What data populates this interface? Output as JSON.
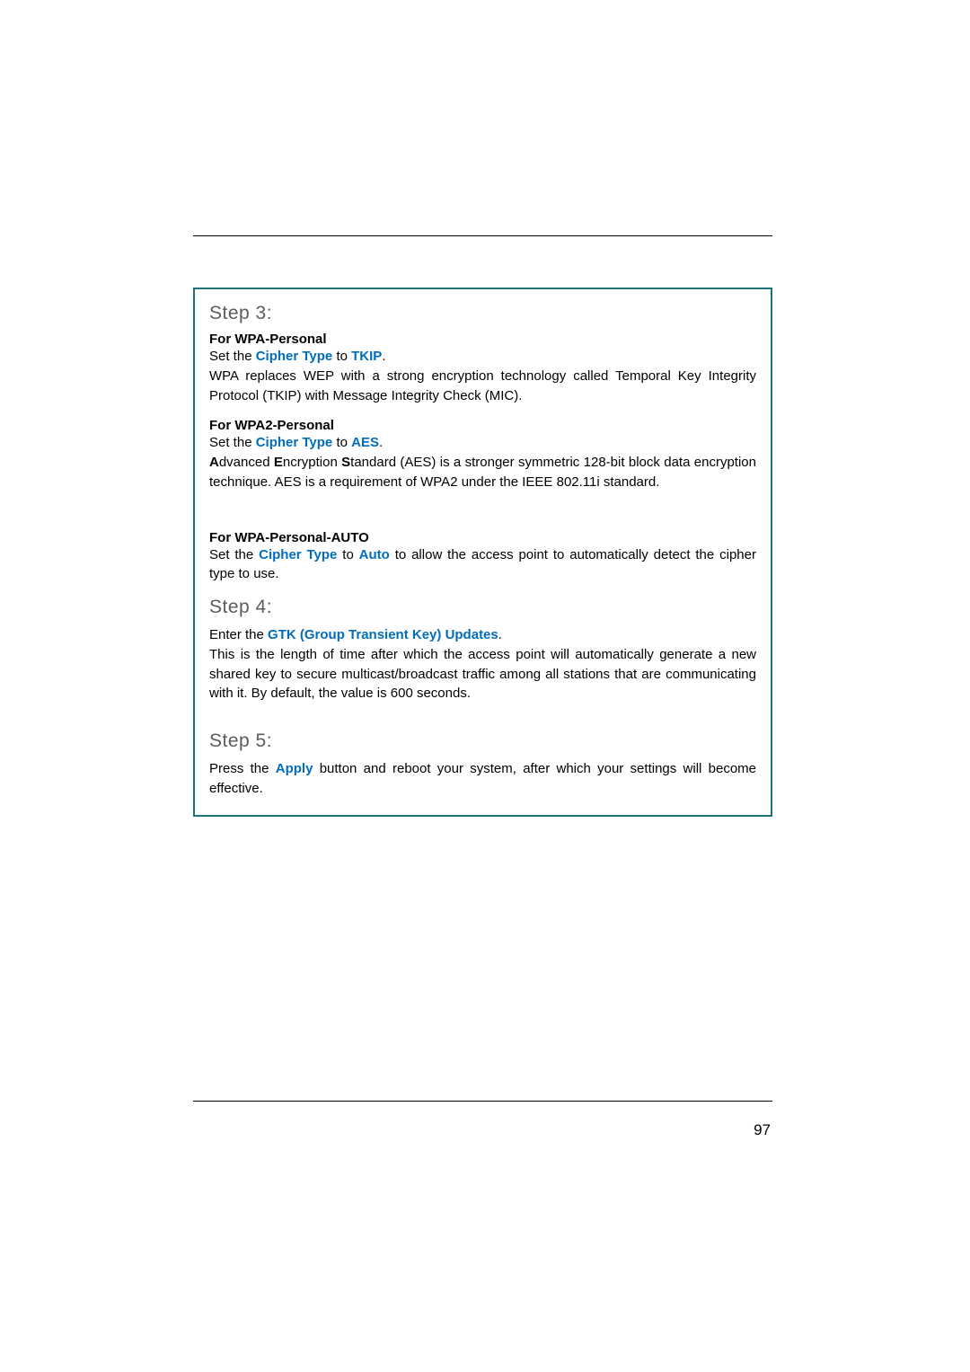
{
  "page_number": "97",
  "step3": {
    "heading": "Step 3:",
    "wpa_personal": {
      "title": "For WPA-Personal",
      "line1_a": "Set the ",
      "cipher_label": "Cipher Type",
      "line1_b": " to ",
      "cipher_value": "TKIP",
      "line1_c": ".",
      "desc": "WPA replaces WEP with a strong encryption technology called Temporal Key Integrity Protocol (TKIP) with Message Integrity Check (MIC)."
    },
    "wpa2_personal": {
      "title": "For WPA2-Personal",
      "line1_a": "Set the ",
      "cipher_label": "Cipher Type",
      "line1_b": " to ",
      "cipher_value": "AES",
      "line1_c": ".",
      "desc_a": "A",
      "desc_b": "dvanced ",
      "desc_c": "E",
      "desc_d": "ncryption ",
      "desc_e": "S",
      "desc_f": "tandard (AES) is a stronger symmetric 128-bit block data encryption technique. AES is a requirement of WPA2 under the IEEE 802.11i  standard."
    },
    "wpa_personal_auto": {
      "title": "For WPA-Personal-AUTO",
      "line1_a": "Set the ",
      "cipher_label": "Cipher Type",
      "line1_b": " to ",
      "cipher_value": "Auto",
      "line1_c": " to allow the access point to automatically detect the cipher type to use."
    }
  },
  "step4": {
    "heading": "Step 4:",
    "line1_a": "Enter the ",
    "gtk_label": "GTK (Group Transient Key) Updates",
    "line1_b": ".",
    "desc": "This is the length of time after which the access point will automatically generate a new shared key to secure multicast/broadcast traffic among all stations that are communicating with it. By default, the value is 600 seconds."
  },
  "step5": {
    "heading": "Step 5:",
    "line1_a": "Press the ",
    "apply_label": "Apply",
    "line1_b": " button and reboot your system, after which your settings will become effective."
  }
}
